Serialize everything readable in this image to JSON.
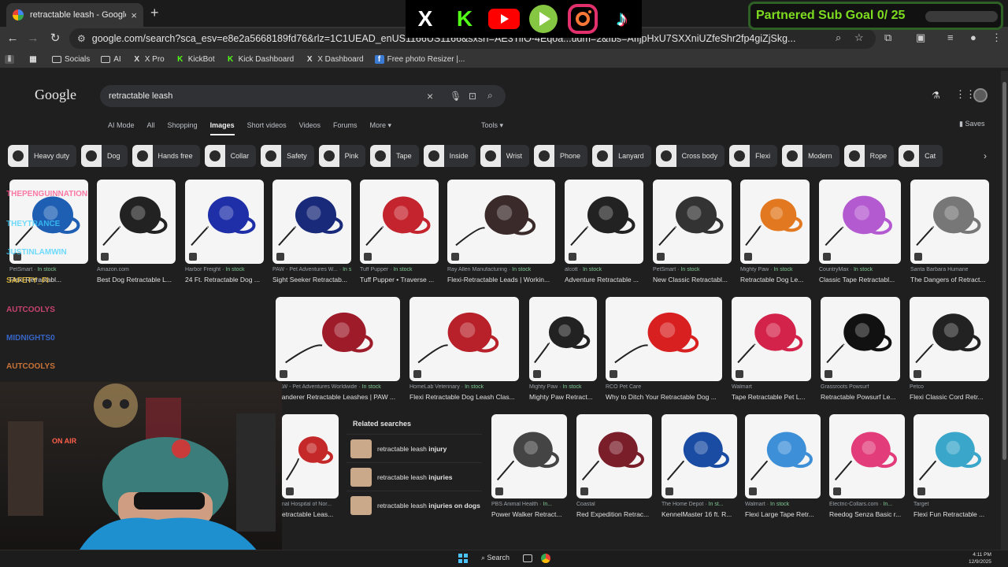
{
  "browser": {
    "tab_title": "retractable leash - Google Search",
    "url": "google.com/search?sca_esv=e8e2a5668189fd76&rlz=1C1UEAD_enUS1166US1166&sxsrf=AE3TifO-4Eqoa...udm=2&fbs=AIIjpHxU7SXXniUZfeShr2fp4giZjSkg...",
    "bookmarks": [
      {
        "label": "Socials",
        "icon": "folder-icon"
      },
      {
        "label": "AI",
        "icon": "folder-icon"
      },
      {
        "label": "X Pro",
        "icon": "x-icon"
      },
      {
        "label": "KickBot",
        "icon": "kick-icon"
      },
      {
        "label": "Kick Dashboard",
        "icon": "kick-icon"
      },
      {
        "label": "X Dashboard",
        "icon": "x-icon"
      },
      {
        "label": "Free photo Resizer |...",
        "icon": "resizer-icon"
      }
    ]
  },
  "google": {
    "logo": "Google",
    "query": "retractable leash",
    "tabs": [
      "AI Mode",
      "All",
      "Shopping",
      "Images",
      "Short videos",
      "Videos",
      "Forums",
      "More"
    ],
    "active_tab": "Images",
    "tools_label": "Tools",
    "saves_label": "Saves",
    "chips": [
      "Heavy duty",
      "Dog",
      "Hands free",
      "Collar",
      "Safety",
      "Pink",
      "Tape",
      "Inside",
      "Wrist",
      "Phone",
      "Lanyard",
      "Cross body",
      "Flexi",
      "Modern",
      "Rope",
      "Cat"
    ],
    "results": [
      {
        "source": "PetSmart",
        "stock": "In stock",
        "title": "Flexi Retractabl..."
      },
      {
        "source": "Amazon.com",
        "stock": "",
        "title": "Best Dog Retractable L..."
      },
      {
        "source": "Harbor Freight",
        "stock": "In stock",
        "title": "24 Ft. Retractable Dog ..."
      },
      {
        "source": "PAW - Pet Adventures W...",
        "stock": "In stock",
        "title": "Sight Seeker Retractab..."
      },
      {
        "source": "Tuff Pupper",
        "stock": "In stock",
        "title": "Tuff Pupper • Traverse ..."
      },
      {
        "source": "Ray Allen Manufacturing",
        "stock": "In stock",
        "title": "Flexi-Retractable Leads | Workin..."
      },
      {
        "source": "alcott",
        "stock": "In stock",
        "title": "Adventure Retractable ..."
      },
      {
        "source": "PetSmart",
        "stock": "In stock",
        "title": "New Classic Retractabl..."
      },
      {
        "source": "Mighty Paw",
        "stock": "In stock",
        "title": "Retractable Dog Le..."
      },
      {
        "source": "CountryMax",
        "stock": "In stock",
        "title": "Classic Tape Retractabl..."
      },
      {
        "source": "Santa Barbara Humane",
        "stock": "",
        "title": "The Dangers of Retract..."
      },
      {
        "source": "PAW - Pet Adventures Worldwide",
        "stock": "In stock",
        "title": "Wanderer Retractable Leashes | PAW ..."
      },
      {
        "source": "HomeLab Veterinary",
        "stock": "In stock",
        "title": "Flexi Retractable Dog Leash Clas..."
      },
      {
        "source": "Mighty Paw",
        "stock": "In stock",
        "title": "Mighty Paw Retract..."
      },
      {
        "source": "RCO Pet Care",
        "stock": "",
        "title": "Why to Ditch Your Retractable Dog ..."
      },
      {
        "source": "Walmart",
        "stock": "",
        "title": "Tape Retractable Pet L..."
      },
      {
        "source": "Grassroots Powsurf",
        "stock": "",
        "title": "Retractable Powsurf Le..."
      },
      {
        "source": "Petco",
        "stock": "",
        "title": "Flexi Classic Cord Retr..."
      },
      {
        "source": "nal Hospital of Nor...",
        "stock": "",
        "title": "etractable Leas..."
      },
      {
        "source": "PBS Animal Health",
        "stock": "In...",
        "title": "Power Walker Retract..."
      },
      {
        "source": "Coastal",
        "stock": "",
        "title": "Red Expedition Retrac..."
      },
      {
        "source": "The Home Depot",
        "stock": "In st...",
        "title": "KennelMaster 16 ft. R..."
      },
      {
        "source": "Walmart",
        "stock": "In stock",
        "title": "Flexi Large Tape Retr..."
      },
      {
        "source": "Electric-Collars.com",
        "stock": "In...",
        "title": "Reedog Senza Basic r..."
      },
      {
        "source": "Target",
        "stock": "",
        "title": "Flexi Fun Retractable ..."
      }
    ],
    "related": {
      "title": "Related searches",
      "items": [
        {
          "prefix": "retractable leash ",
          "bold": "injury"
        },
        {
          "prefix": "retractable leash ",
          "bold": "injuries"
        },
        {
          "prefix": "retractable leash ",
          "bold": "injuries on dogs"
        }
      ]
    }
  },
  "stream": {
    "goal_text": "Partnered Sub Goal 0/ 25",
    "goal_progress": 0,
    "socials": [
      "x-icon",
      "kick-icon",
      "youtube-icon",
      "rumble-icon",
      "instagram-icon",
      "tiktok-icon"
    ],
    "onair": "ON AIR",
    "chat_names": [
      "THEPENGUINNATION",
      "THEYTRANCE",
      "JUSTINLAMWIN",
      "SAFETY_FI",
      "AUTCOOLYS",
      "MIDNIGHTS0",
      "AUTCOOLYS"
    ]
  },
  "taskbar": {
    "search_label": "Search",
    "time": "4:11 PM",
    "date": "12/9/2025"
  },
  "colors": {
    "goal_green": "#7ddc1f",
    "in_stock": "#81c995",
    "page_bg": "#1f1f1f"
  }
}
